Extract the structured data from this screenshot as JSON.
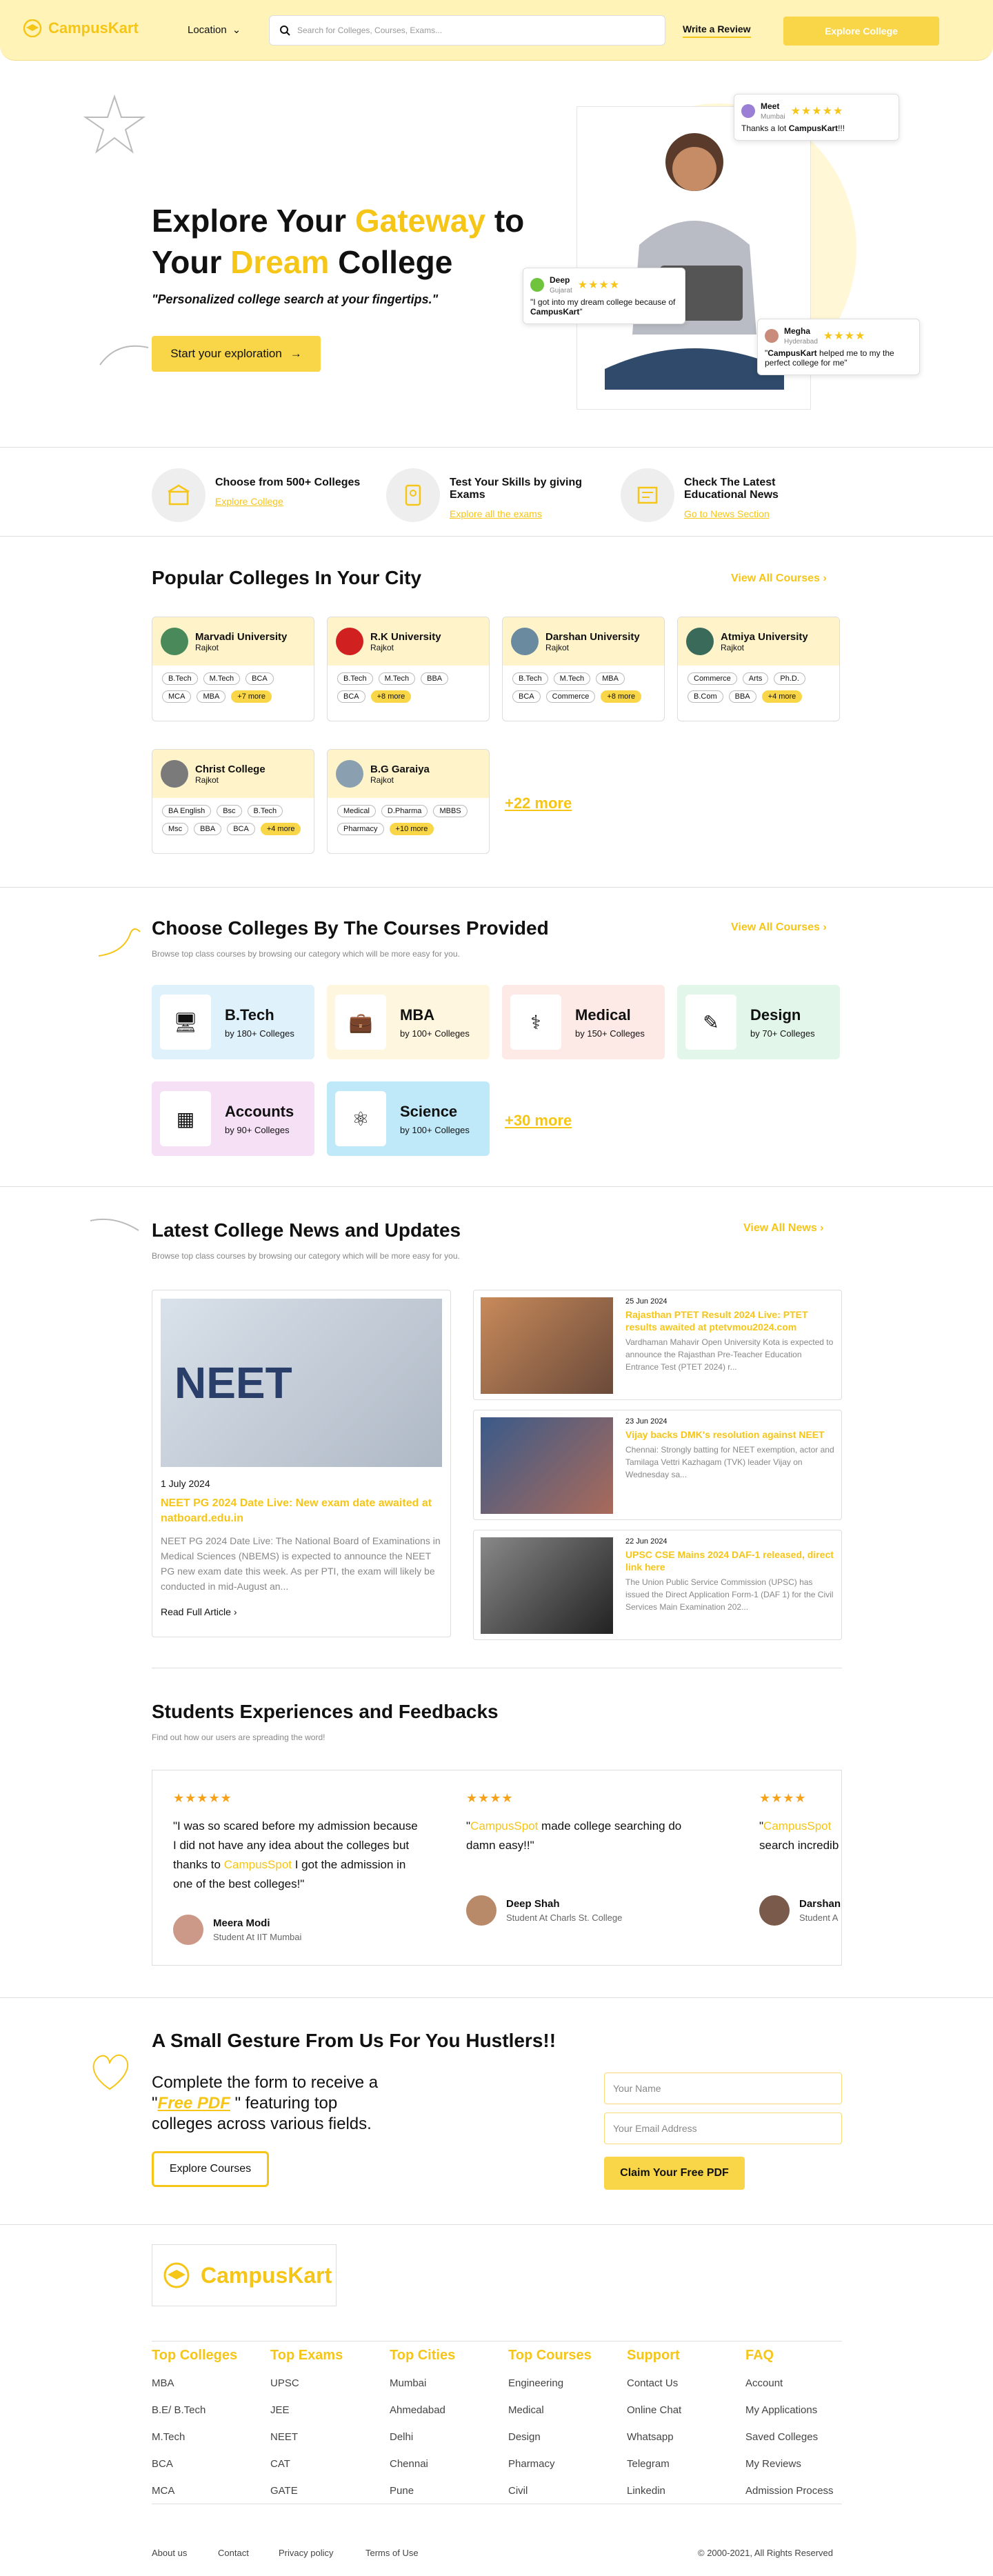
{
  "header": {
    "logo": "CampusKart",
    "location": "Location",
    "search_placeholder": "Search for Colleges, Courses, Exams...",
    "write_review": "Write a Review",
    "explore": "Explore College"
  },
  "hero": {
    "t1": "Explore Your ",
    "t2": "Gateway",
    "t3": " to",
    "t4": "Your ",
    "t5": "Dream",
    "t6": " College",
    "sub": "\"Personalized college search at your fingertips.\"",
    "btn": "Start your exploration",
    "r1": {
      "name": "Meet",
      "city": "Mumbai",
      "text": "Thanks a lot ",
      "brand": "CampusKart",
      "tail": "!!!"
    },
    "r2": {
      "name": "Deep",
      "city": "Gujarat",
      "text": "\"I got into my dream college because of ",
      "brand": "CampusKart",
      "tail": "\""
    },
    "r3": {
      "name": "Megha",
      "city": "Hyderabad",
      "text": "\"",
      "brand": "CampusKart",
      "tail": " helped me to my the perfect college for me\""
    }
  },
  "features": [
    {
      "title": "Choose from 500+ Colleges",
      "link": "Explore College"
    },
    {
      "title": "Test Your Skills by giving Exams",
      "link": "Explore all the exams"
    },
    {
      "title": "Check The Latest Educational News",
      "link": "Go to News Section"
    }
  ],
  "popular": {
    "title": "Popular Colleges In Your City",
    "view": "View All Courses",
    "more": "+22 more",
    "cards": [
      {
        "name": "Marvadi University",
        "city": "Rajkot",
        "tags": [
          "B.Tech",
          "M.Tech",
          "BCA",
          "MCA",
          "MBA"
        ],
        "more": "+7 more"
      },
      {
        "name": "R.K University",
        "city": "Rajkot",
        "tags": [
          "B.Tech",
          "M.Tech",
          "BBA",
          "BCA"
        ],
        "more": "+8 more"
      },
      {
        "name": "Darshan University",
        "city": "Rajkot",
        "tags": [
          "B.Tech",
          "M.Tech",
          "MBA",
          "BCA",
          "Commerce"
        ],
        "more": "+8 more"
      },
      {
        "name": "Atmiya University",
        "city": "Rajkot",
        "tags": [
          "Commerce",
          "Arts",
          "Ph.D.",
          "B.Com",
          "BBA"
        ],
        "more": "+4 more"
      },
      {
        "name": "Christ College",
        "city": "Rajkot",
        "tags": [
          "BA English",
          "Bsc",
          "B.Tech",
          "Msc",
          "BBA",
          "BCA"
        ],
        "more": "+4 more"
      },
      {
        "name": "B.G Garaiya",
        "city": "Rajkot",
        "tags": [
          "Medical",
          "D.Pharma",
          "MBBS",
          "Pharmacy"
        ],
        "more": "+10 more"
      }
    ]
  },
  "courses": {
    "title": "Choose Colleges By The Courses Provided",
    "view": "View All Courses",
    "sub": "Browse top class courses by browsing our category which will be more easy for you.",
    "more": "+30 more",
    "items": [
      {
        "name": "B.Tech",
        "count": "by 180+ Colleges",
        "bg": "#dff1fb"
      },
      {
        "name": "MBA",
        "count": "by 100+ Colleges",
        "bg": "#fff6df"
      },
      {
        "name": "Medical",
        "count": "by 150+ Colleges",
        "bg": "#fde9e6"
      },
      {
        "name": "Design",
        "count": "by 70+ Colleges",
        "bg": "#e3f6ea"
      },
      {
        "name": "Accounts",
        "count": "by 90+ Colleges",
        "bg": "#f6e0f6"
      },
      {
        "name": "Science",
        "count": "by 100+ Colleges",
        "bg": "#bfe9f9"
      }
    ]
  },
  "news": {
    "title": "Latest College News and Updates",
    "view": "View All News",
    "sub": "Browse top class courses by browsing our category which will be more easy for you.",
    "big": {
      "date": "1 July 2024",
      "title": "NEET PG 2024 Date Live: New exam date awaited at natboard.edu.in",
      "desc": "NEET PG 2024 Date Live: The National Board of Examinations in Medical Sciences (NBEMS) is expected to announce the NEET PG new exam date this week. As per PTI, the exam will likely be conducted in mid-August an...",
      "read": "Read Full Article",
      "img_text": "NEET"
    },
    "items": [
      {
        "date": "25 Jun 2024",
        "title": "Rajasthan PTET Result 2024 Live: PTET results awaited at ptetvmou2024.com",
        "desc": "Vardhaman Mahavir Open University Kota is expected to announce the Rajasthan Pre-Teacher Education Entrance Test (PTET 2024) r..."
      },
      {
        "date": "23 Jun 2024",
        "title": "Vijay backs DMK's resolution against NEET",
        "desc": "Chennai: Strongly batting for NEET exemption, actor and Tamilaga Vettri Kazhagam (TVK) leader Vijay on Wednesday sa..."
      },
      {
        "date": "22 Jun 2024",
        "title": "UPSC CSE Mains 2024 DAF-1 released, direct link here",
        "desc": "The Union Public Service Commission (UPSC) has issued the Direct Application Form-1 (DAF 1) for the Civil Services Main Examination 202..."
      }
    ]
  },
  "testimonials": {
    "title": "Students Experiences and Feedbacks",
    "sub": "Find out how our users are spreading the word!",
    "items": [
      {
        "q1": "\"I was so scared before my admission because I did not have any idea about the colleges but thanks to ",
        "brand": "CampusSpot",
        "q2": " I got the admission in one of the best colleges!\"",
        "name": "Meera Modi",
        "role": "Student At IIT Mumbai"
      },
      {
        "q1": "\"",
        "brand": "CampusSpot",
        "q2": " made college searching do damn easy!!\"",
        "name": "Deep Shah",
        "role": "Student At Charls St. College"
      },
      {
        "q1": "\"",
        "brand": "CampusSpot",
        "q2": " search incredib",
        "name": "Darshan",
        "role": "Student A"
      }
    ]
  },
  "gesture": {
    "title": "A Small Gesture From Us For You Hustlers!!",
    "l1": "Complete the form to receive a",
    "q": "\"",
    "pdf": "Free PDF",
    "l2": " \" featuring top",
    "l3": "colleges across various fields.",
    "btn": "Explore Courses",
    "name_ph": "Your Name",
    "email_ph": "Your Email Address",
    "claim": "Claim Your Free PDF"
  },
  "footer": {
    "logo": "CampusKart",
    "cols": [
      {
        "head": "Top Colleges",
        "items": [
          "MBA",
          "B.E/ B.Tech",
          "M.Tech",
          "BCA",
          "MCA"
        ]
      },
      {
        "head": "Top Exams",
        "items": [
          "UPSC",
          "JEE",
          "NEET",
          "CAT",
          "GATE"
        ]
      },
      {
        "head": "Top Cities",
        "items": [
          "Mumbai",
          "Ahmedabad",
          "Delhi",
          "Chennai",
          "Pune"
        ]
      },
      {
        "head": "Top Courses",
        "items": [
          "Engineering",
          "Medical",
          "Design",
          "Pharmacy",
          "Civil"
        ]
      },
      {
        "head": "Support",
        "items": [
          "Contact Us",
          "Online Chat",
          "Whatsapp",
          "Telegram",
          "Linkedin"
        ]
      },
      {
        "head": "FAQ",
        "items": [
          "Account",
          "My Applications",
          "Saved Colleges",
          "My Reviews",
          "Admission Process"
        ]
      }
    ],
    "links": [
      "About us",
      "Contact",
      "Privacy policy",
      "Terms of Use"
    ],
    "copy": "© 2000-2021, All Rights Reserved"
  },
  "colors": {
    "accent": "#f5c518",
    "header_bg": "#fff3b8"
  }
}
